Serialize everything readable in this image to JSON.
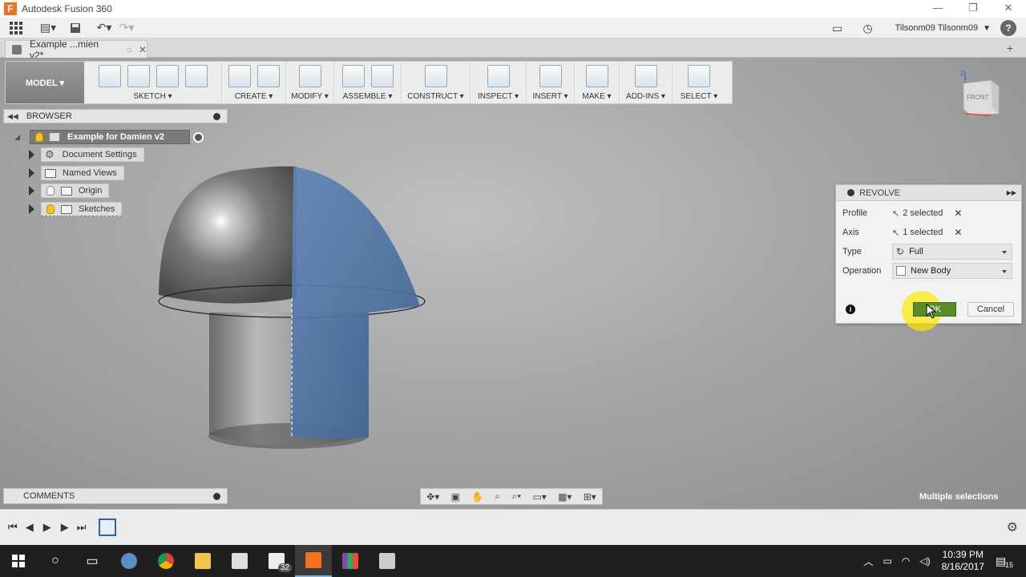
{
  "window": {
    "title": "Autodesk Fusion 360"
  },
  "qat": {
    "user": "Tilsonm09 Tilsonm09",
    "help": "?"
  },
  "tab": {
    "name": "Example ...mien v2*"
  },
  "toolbar": {
    "workspace": "MODEL ▾",
    "groups": {
      "sketch": "SKETCH ▾",
      "create": "CREATE ▾",
      "modify": "MODIFY ▾",
      "assemble": "ASSEMBLE ▾",
      "construct": "CONSTRUCT ▾",
      "inspect": "INSPECT ▾",
      "insert": "INSERT ▾",
      "make": "MAKE ▾",
      "addins": "ADD-INS ▾",
      "select": "SELECT ▾"
    }
  },
  "browser": {
    "title": "BROWSER",
    "root": "Example for Damien v2",
    "items": [
      "Document Settings",
      "Named Views",
      "Origin",
      "Sketches"
    ]
  },
  "viewcube": {
    "face": "FRONT"
  },
  "revolve": {
    "title": "REVOLVE",
    "profile_label": "Profile",
    "profile_value": "2 selected",
    "axis_label": "Axis",
    "axis_value": "1 selected",
    "type_label": "Type",
    "type_value": "Full",
    "operation_label": "Operation",
    "operation_value": "New Body",
    "ok": "OK",
    "cancel": "Cancel"
  },
  "status": {
    "comments": "COMMENTS",
    "selection": "Multiple selections"
  },
  "taskbar": {
    "mail_badge": "32",
    "time": "10:39 PM",
    "date": "8/16/2017",
    "notif": "15"
  }
}
